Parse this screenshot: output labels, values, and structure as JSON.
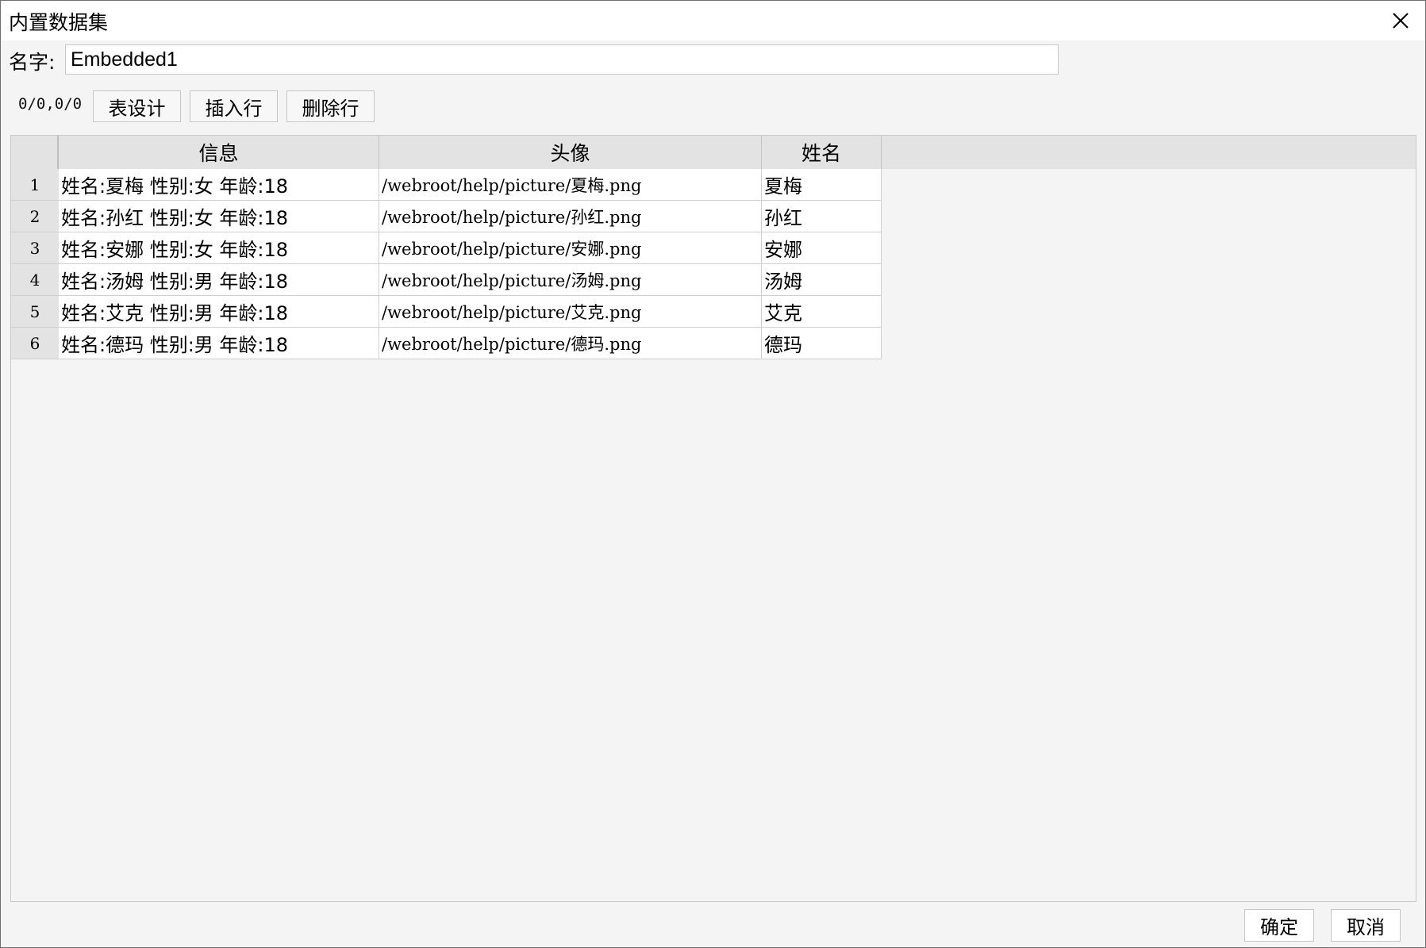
{
  "window": {
    "title": "内置数据集",
    "close_icon": "close-icon"
  },
  "name_field": {
    "label": "名字:",
    "value": "Embedded1"
  },
  "toolbar": {
    "position_text": "0/0,0/0",
    "table_design_label": "表设计",
    "insert_row_label": "插入行",
    "delete_row_label": "删除行"
  },
  "table": {
    "columns": [
      "信息",
      "头像",
      "姓名"
    ],
    "rows": [
      {
        "num": "1",
        "info": "姓名:夏梅 性别:女 年龄:18",
        "avatar": "/webroot/help/picture/夏梅.png",
        "name": "夏梅"
      },
      {
        "num": "2",
        "info": "姓名:孙红 性别:女 年龄:18",
        "avatar": "/webroot/help/picture/孙红.png",
        "name": "孙红"
      },
      {
        "num": "3",
        "info": "姓名:安娜 性别:女 年龄:18",
        "avatar": "/webroot/help/picture/安娜.png",
        "name": "安娜"
      },
      {
        "num": "4",
        "info": "姓名:汤姆 性别:男 年龄:18",
        "avatar": "/webroot/help/picture/汤姆.png",
        "name": "汤姆"
      },
      {
        "num": "5",
        "info": "姓名:艾克 性别:男 年龄:18",
        "avatar": "/webroot/help/picture/艾克.png",
        "name": "艾克"
      },
      {
        "num": "6",
        "info": "姓名:德玛 性别:男 年龄:18",
        "avatar": "/webroot/help/picture/德玛.png",
        "name": "德玛"
      }
    ]
  },
  "footer": {
    "ok_label": "确定",
    "cancel_label": "取消"
  }
}
